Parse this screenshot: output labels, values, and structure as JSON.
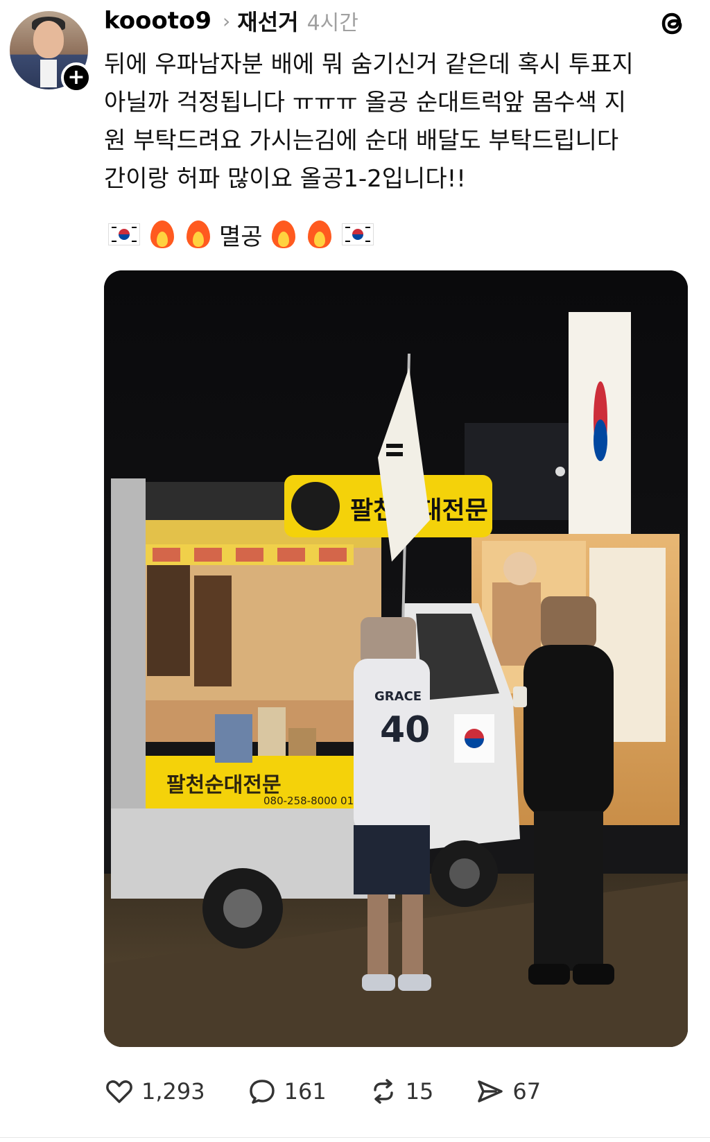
{
  "post": {
    "username": "koooto9",
    "topic": "재선거",
    "time": "4시간",
    "body_lines": [
      "뒤에 우파남자분 배에 뭐 숨기신거 같은데 혹시 투표지",
      "아닐까 걱정됩니다 ㅠㅠㅠ 올공 순대트럭앞 몸수색 지",
      "원 부탁드려요 가시는김에 순대 배달도 부탁드립니다",
      "간이랑 허파 많이요 올공1-2입니다!!"
    ],
    "emoji_word": "멸공",
    "photo": {
      "sign_text": "팔천순대전문",
      "truck_banner": "팔천순대전문",
      "truck_phone": "080-258-8000  010-4500",
      "shirt_number": "40",
      "shirt_text": "GRACE"
    }
  },
  "actions": {
    "likes": "1,293",
    "replies": "161",
    "reposts": "15",
    "shares": "67"
  },
  "icons": {
    "follow": "plus-icon",
    "threads": "threads-logo-icon",
    "like": "heart-icon",
    "reply": "comment-icon",
    "repost": "repost-icon",
    "share": "send-icon"
  },
  "colors": {
    "text": "#111111",
    "muted": "#a0a0a0",
    "sign_yellow": "#f4d20a"
  }
}
